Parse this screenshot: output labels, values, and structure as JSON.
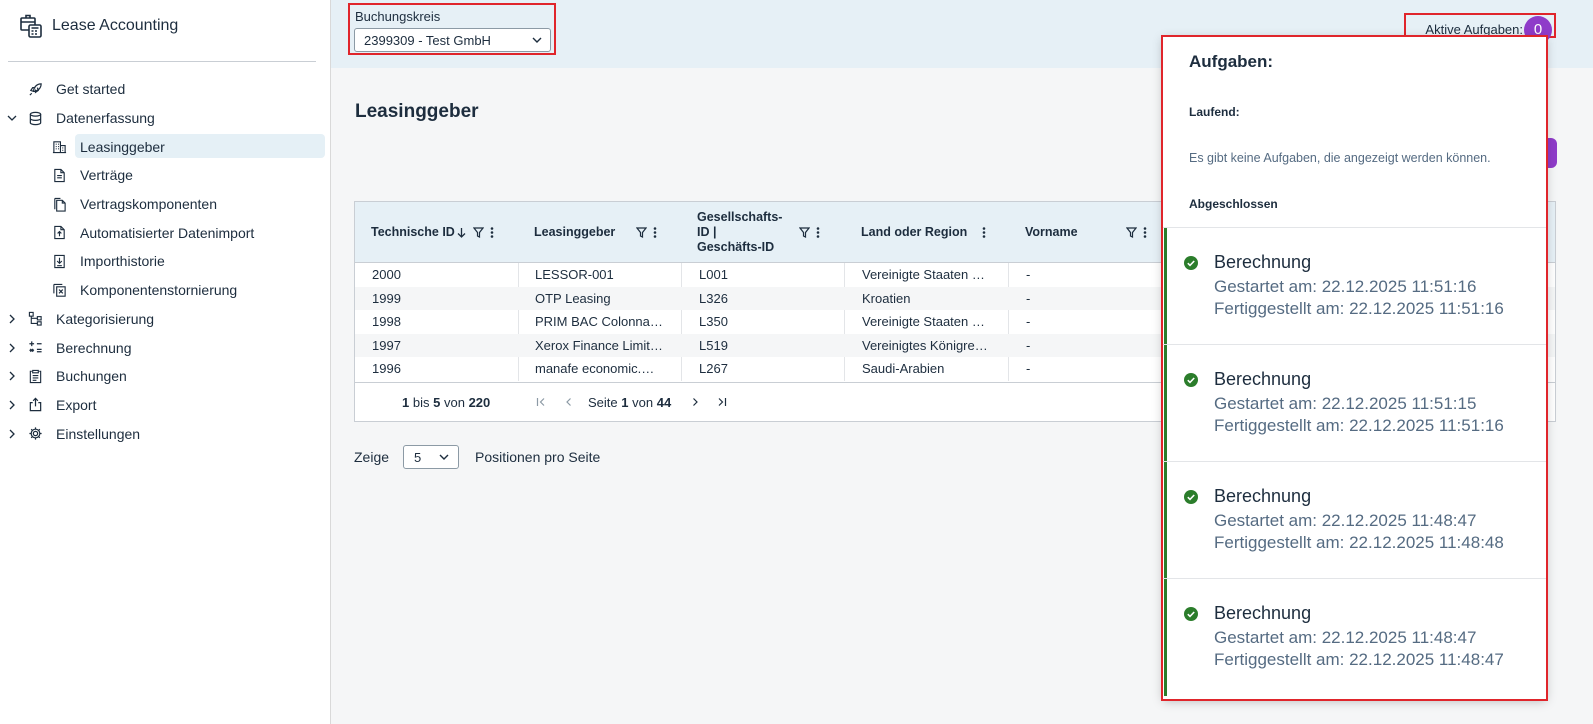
{
  "app": {
    "title": "Lease Accounting"
  },
  "sidebar": {
    "items": [
      {
        "label": "Get started"
      },
      {
        "label": "Datenerfassung"
      },
      {
        "label": "Leasinggeber"
      },
      {
        "label": "Verträge"
      },
      {
        "label": "Vertragskomponenten"
      },
      {
        "label": "Automatisierter Datenimport"
      },
      {
        "label": "Importhistorie"
      },
      {
        "label": "Komponentenstornierung"
      },
      {
        "label": "Kategorisierung"
      },
      {
        "label": "Berechnung"
      },
      {
        "label": "Buchungen"
      },
      {
        "label": "Export"
      },
      {
        "label": "Einstellungen"
      }
    ]
  },
  "header": {
    "company_label": "Buchungskreis",
    "company_value": "2399309 - Test GmbH",
    "active_tasks_label": "Aktive Aufgaben:",
    "active_tasks_count": "0"
  },
  "page": {
    "title": "Leasinggeber"
  },
  "table": {
    "columns": [
      {
        "label": "Technische ID"
      },
      {
        "label": "Leasinggeber"
      },
      {
        "label": "Gesellschafts-ID | Geschäfts-ID",
        "lines": [
          "Gesellschafts-",
          "ID |",
          "Geschäfts-ID"
        ]
      },
      {
        "label": "Land oder Region"
      },
      {
        "label": "Vorname"
      }
    ],
    "rows": [
      [
        "2000",
        "LESSOR-001",
        "L001",
        "Vereinigte Staaten …",
        "-"
      ],
      [
        "1999",
        "OTP Leasing",
        "L326",
        "Kroatien",
        "-"
      ],
      [
        "1998",
        "PRIM BAC Colonna…",
        "L350",
        "Vereinigte Staaten …",
        "-"
      ],
      [
        "1997",
        "Xerox Finance Limit…",
        "L519",
        "Vereinigtes Königre…",
        "-"
      ],
      [
        "1996",
        "manafe economic.…",
        "L267",
        "Saudi-Arabien",
        "-"
      ]
    ],
    "pager": {
      "from": "1",
      "bis": "bis",
      "to": "5",
      "von": "von",
      "total": "220",
      "page_label": "Seite",
      "page": "1",
      "of_label": "von",
      "pages": "44"
    }
  },
  "page_size": {
    "show_label": "Zeige",
    "value": "5",
    "suffix": "Positionen pro Seite"
  },
  "tasks_panel": {
    "title": "Aufgaben:",
    "running_label": "Laufend:",
    "empty_text": "Es gibt keine Aufgaben, die angezeigt werden können.",
    "done_label": "Abgeschlossen",
    "tasks": [
      {
        "name": "Berechnung",
        "started": "Gestartet am: 22.12.2025 11:51:16",
        "finished": "Fertiggestellt am: 22.12.2025 11:51:16"
      },
      {
        "name": "Berechnung",
        "started": "Gestartet am: 22.12.2025 11:51:15",
        "finished": "Fertiggestellt am: 22.12.2025 11:51:16"
      },
      {
        "name": "Berechnung",
        "started": "Gestartet am: 22.12.2025 11:48:47",
        "finished": "Fertiggestellt am: 22.12.2025 11:48:48"
      },
      {
        "name": "Berechnung",
        "started": "Gestartet am: 22.12.2025 11:48:47",
        "finished": "Fertiggestellt am: 22.12.2025 11:48:47"
      }
    ]
  },
  "colors": {
    "accent": "#8f3cc9",
    "highlight": "#e0252b",
    "success": "#2b7d2b",
    "header_bg": "#e6f0f6"
  }
}
